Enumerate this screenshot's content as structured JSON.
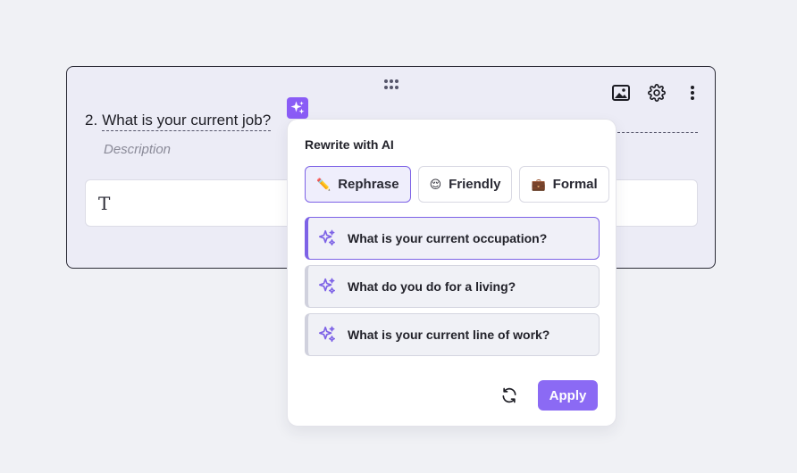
{
  "question": {
    "number": "2.",
    "title": "What is your current job?",
    "description_placeholder": "Description"
  },
  "answer": {
    "type_icon_label": "T"
  },
  "ai_panel": {
    "title": "Rewrite with AI",
    "tones": [
      {
        "emoji": "✏️",
        "label": "Rephrase"
      },
      {
        "emoji": "😌",
        "label": "Friendly"
      },
      {
        "emoji": "💼",
        "label": "Formal"
      }
    ],
    "suggestions": [
      "What is your current occupation?",
      "What do you do for a living?",
      "What is your current line of work?"
    ],
    "apply_label": "Apply"
  },
  "colors": {
    "accent": "#8b6af4",
    "card_bg": "#ececf6",
    "page_bg": "#f0f1f5"
  }
}
